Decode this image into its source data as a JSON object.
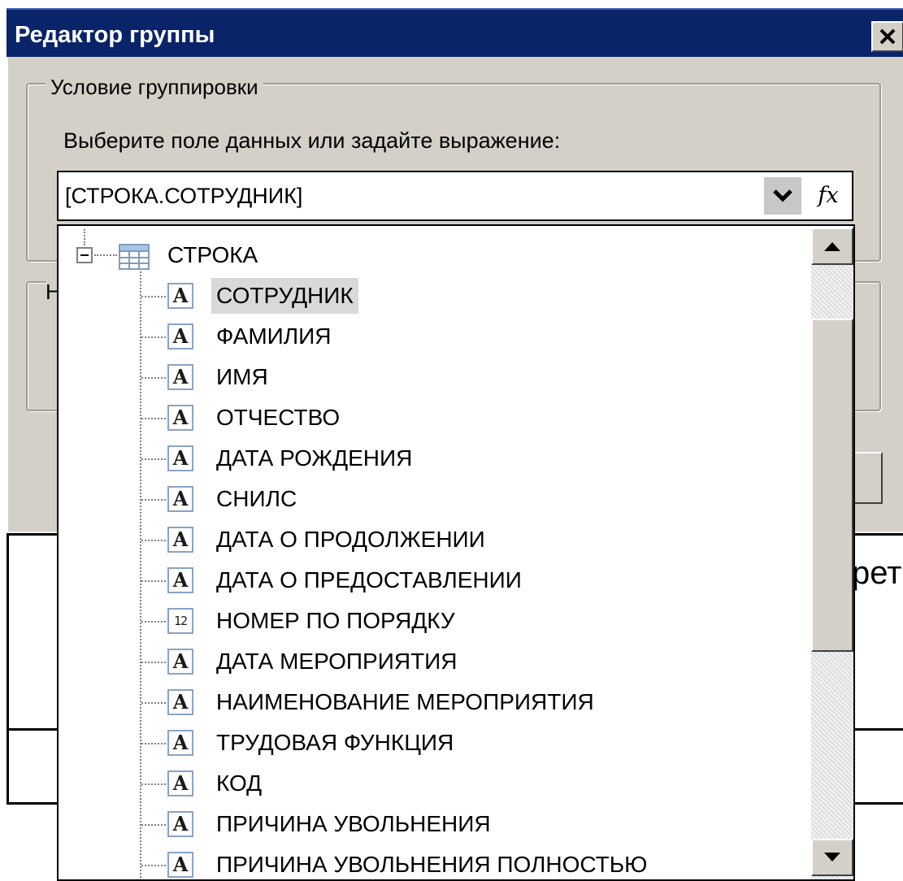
{
  "window": {
    "title": "Редактор группы",
    "close_icon": "close-icon"
  },
  "grouping": {
    "legend": "Условие группировки",
    "prompt": "Выберите поле данных или задайте выражение:",
    "expression_value": "[СТРОКА.СОТРУДНИК]",
    "fx_label": "fx"
  },
  "hidden_group": {
    "legend_fragment": "Н"
  },
  "report": {
    "text_fragment": "рет"
  },
  "tree": {
    "root": {
      "label": "СТРОКА",
      "icon": "table-icon",
      "expanded": true
    },
    "fields": [
      {
        "label": "СОТРУДНИК",
        "type": "text",
        "icon_glyph": "A",
        "selected": true
      },
      {
        "label": "ФАМИЛИЯ",
        "type": "text",
        "icon_glyph": "A"
      },
      {
        "label": "ИМЯ",
        "type": "text",
        "icon_glyph": "A"
      },
      {
        "label": "ОТЧЕСТВО",
        "type": "text",
        "icon_glyph": "A"
      },
      {
        "label": "ДАТА РОЖДЕНИЯ",
        "type": "text",
        "icon_glyph": "A"
      },
      {
        "label": "СНИЛС",
        "type": "text",
        "icon_glyph": "A"
      },
      {
        "label": "ДАТА О ПРОДОЛЖЕНИИ",
        "type": "text",
        "icon_glyph": "A"
      },
      {
        "label": "ДАТА О ПРЕДОСТАВЛЕНИИ",
        "type": "text",
        "icon_glyph": "A"
      },
      {
        "label": "НОМЕР ПО ПОРЯДКУ",
        "type": "number",
        "icon_glyph": "12"
      },
      {
        "label": "ДАТА МЕРОПРИЯТИЯ",
        "type": "text",
        "icon_glyph": "A"
      },
      {
        "label": "НАИМЕНОВАНИЕ МЕРОПРИЯТИЯ",
        "type": "text",
        "icon_glyph": "A"
      },
      {
        "label": "ТРУДОВАЯ ФУНКЦИЯ",
        "type": "text",
        "icon_glyph": "A"
      },
      {
        "label": "КОД",
        "type": "text",
        "icon_glyph": "A"
      },
      {
        "label": "ПРИЧИНА УВОЛЬНЕНИЯ",
        "type": "text",
        "icon_glyph": "A"
      },
      {
        "label": "ПРИЧИНА УВОЛЬНЕНИЯ ПОЛНОСТЬЮ",
        "type": "text",
        "icon_glyph": "A"
      }
    ]
  },
  "scrollbar": {
    "up_icon": "arrow-up-icon",
    "down_icon": "arrow-down-icon",
    "position_fraction": 0.0,
    "visible_fraction": 0.55
  },
  "colors": {
    "titlebar": "#0a246a",
    "dialog_face": "#d4d0c8",
    "selection": "#d9d9d9"
  }
}
